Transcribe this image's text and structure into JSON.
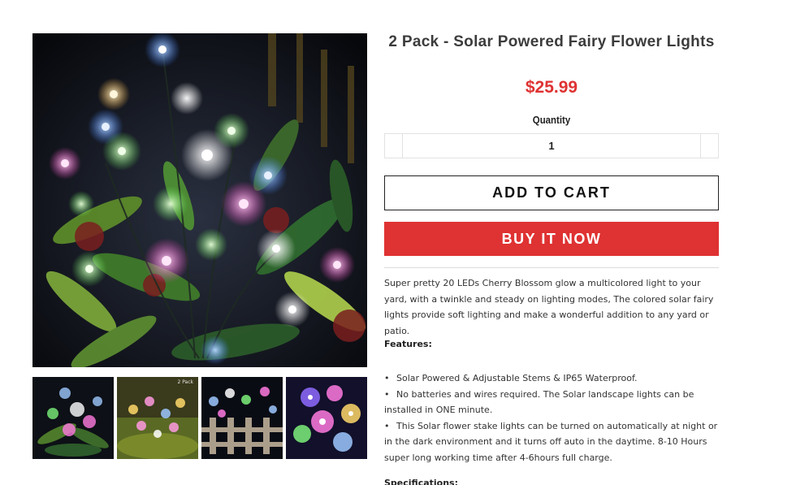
{
  "product": {
    "title": "2 Pack - Solar Powered Fairy Flower Lights",
    "price": "$25.99",
    "quantity_label": "Quantity",
    "quantity_value": "1"
  },
  "buttons": {
    "add_to_cart": "ADD TO CART",
    "buy_now": "BUY IT NOW"
  },
  "description": "Super pretty 20 LEDs Cherry Blossom glow a multicolored light to your yard, with a twinkle and steady on lighting modes, The colored solar fairy lights provide soft lighting and make a wonderful addition to any yard or patio.",
  "features": {
    "heading": "Features:",
    "items": [
      "Solar Powered & Adjustable Stems & IP65 Waterproof.",
      "No batteries and wires required. The Solar landscape lights can be installed in ONE minute.",
      "This Solar flower stake lights can be turned on automatically at night or in the dark environment and it turns off auto in the daytime. 8-10 Hours super long working time after 4-6hours full charge."
    ]
  },
  "specifications_heading": "Specifications:",
  "gallery": {
    "thumb_badge": "2 Pack"
  },
  "colors": {
    "accent_red": "#df3232",
    "text_dark": "#3c3c3c"
  }
}
